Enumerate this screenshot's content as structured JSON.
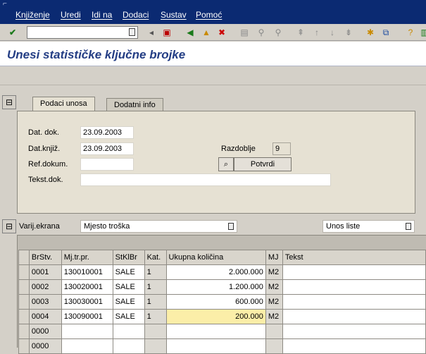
{
  "menu": [
    "Knjiženje",
    "Uredi",
    "Idi na",
    "Dodaci",
    "Sustav",
    "Pomoć"
  ],
  "toolbar": {
    "command_value": "",
    "icons": [
      "enter-check-icon",
      "back-arrow-icon",
      "save-icon",
      "nav-back-icon",
      "exit-icon",
      "cancel-icon",
      "print-icon",
      "find-icon",
      "find-next-icon",
      "first-page-icon",
      "prev-page-icon",
      "next-page-icon",
      "last-page-icon",
      "create-session-icon",
      "shortcut-icon",
      "help-icon",
      "layout-icon"
    ]
  },
  "title": "Unesi statističke ključne brojke",
  "tabs": [
    {
      "label": "Podaci unosa",
      "active": true
    },
    {
      "label": "Dodatni info",
      "active": false
    }
  ],
  "form": {
    "doc_date_label": "Dat. dok.",
    "doc_date": "23.09.2003",
    "post_date_label": "Dat.knjiž.",
    "post_date": "23.09.2003",
    "ref_doc_label": "Ref.dokum.",
    "ref_doc": "",
    "text_label": "Tekst.dok.",
    "text": "",
    "period_label": "Razdoblje",
    "period": "9",
    "confirm_label": "Potvrdi"
  },
  "screen_variant": {
    "label": "Varij.ekrana",
    "value": "Mjesto troška",
    "list_entry": "Unos liste"
  },
  "table": {
    "columns": [
      "BrStv.",
      "Mj.tr.pr.",
      "StKlBr",
      "Kat.",
      "Ukupna količina",
      "MJ",
      "Tekst"
    ],
    "rows": [
      {
        "item": "0001",
        "cost_center": "130010001",
        "skf": "SALE",
        "cat": "1",
        "qty": "2.000.000",
        "unit": "M2",
        "text": ""
      },
      {
        "item": "0002",
        "cost_center": "130020001",
        "skf": "SALE",
        "cat": "1",
        "qty": "1.200.000",
        "unit": "M2",
        "text": ""
      },
      {
        "item": "0003",
        "cost_center": "130030001",
        "skf": "SALE",
        "cat": "1",
        "qty": "600.000",
        "unit": "M2",
        "text": ""
      },
      {
        "item": "0004",
        "cost_center": "130090001",
        "skf": "SALE",
        "cat": "1",
        "qty": "200.000",
        "unit": "M2",
        "text": ""
      },
      {
        "item": "0000",
        "cost_center": "",
        "skf": "",
        "cat": "",
        "qty": "",
        "unit": "",
        "text": ""
      },
      {
        "item": "0000",
        "cost_center": "",
        "skf": "",
        "cat": "",
        "qty": "",
        "unit": "",
        "text": ""
      }
    ]
  }
}
